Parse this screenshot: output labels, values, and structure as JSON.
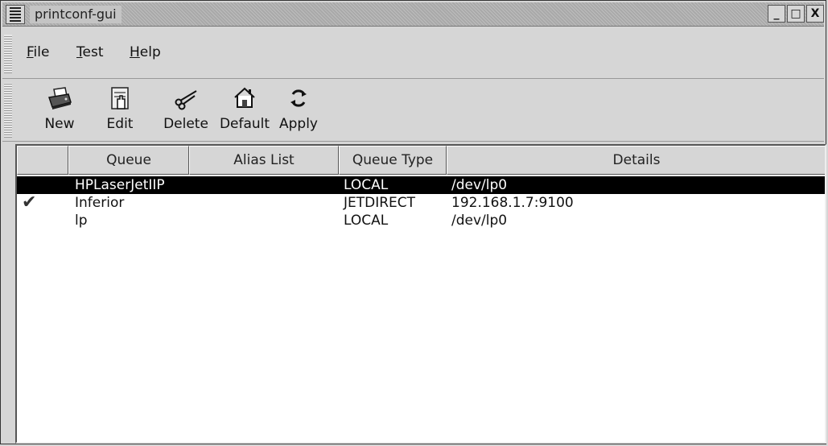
{
  "window": {
    "title": "printconf-gui",
    "minimize_label": "_",
    "maximize_label": "□",
    "close_label": "X"
  },
  "menubar": {
    "items": [
      {
        "label": "File",
        "mnemonic": "F",
        "rest": "ile"
      },
      {
        "label": "Test",
        "mnemonic": "T",
        "rest": "est"
      },
      {
        "label": "Help",
        "mnemonic": "H",
        "rest": "elp"
      }
    ]
  },
  "toolbar": {
    "buttons": [
      {
        "label": "New",
        "icon": "printer-icon"
      },
      {
        "label": "Edit",
        "icon": "edit-icon"
      },
      {
        "label": "Delete",
        "icon": "scissors-icon"
      },
      {
        "label": "Default",
        "icon": "home-icon"
      },
      {
        "label": "Apply",
        "icon": "refresh-icon"
      }
    ]
  },
  "table": {
    "columns": [
      "",
      "Queue",
      "Alias List",
      "Queue Type",
      "Details"
    ],
    "rows": [
      {
        "default": false,
        "queue": "HPLaserJetIIP",
        "alias": "",
        "type": "LOCAL",
        "details": "/dev/lp0",
        "selected": true
      },
      {
        "default": true,
        "queue": "Inferior",
        "alias": "",
        "type": "JETDIRECT",
        "details": "192.168.1.7:9100",
        "selected": false
      },
      {
        "default": false,
        "queue": "lp",
        "alias": "",
        "type": "LOCAL",
        "details": "/dev/lp0",
        "selected": false
      }
    ],
    "check_glyph": "✔"
  }
}
